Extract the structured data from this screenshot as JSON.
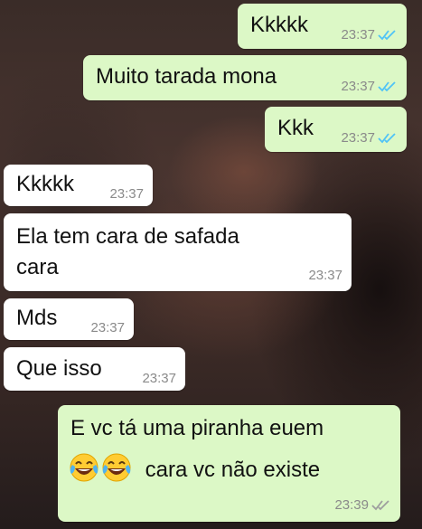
{
  "colors": {
    "outgoing_bubble": "#dcf8c6",
    "incoming_bubble": "#ffffff",
    "read_ticks": "#4fc3f7",
    "delivered_ticks": "#9e9e9e"
  },
  "messages": [
    {
      "direction": "outgoing",
      "text": "Kkkkk",
      "time": "23:37",
      "status": "read"
    },
    {
      "direction": "outgoing",
      "text": "Muito tarada mona",
      "time": "23:37",
      "status": "read"
    },
    {
      "direction": "outgoing",
      "text": "Kkk",
      "time": "23:37",
      "status": "read"
    },
    {
      "direction": "incoming",
      "text": "Kkkkk",
      "time": "23:37"
    },
    {
      "direction": "incoming",
      "text_line1": "Ela tem cara de safada",
      "text_line2": "cara",
      "time": "23:37"
    },
    {
      "direction": "incoming",
      "text": "Mds",
      "time": "23:37"
    },
    {
      "direction": "incoming",
      "text": "Que isso",
      "time": "23:37"
    },
    {
      "direction": "outgoing",
      "text_line1": "E vc tá uma piranha euem",
      "text_line2": "cara vc não existe",
      "emoji": "😂😂",
      "emoji_icons": [
        "tears-of-joy-emoji-icon",
        "tears-of-joy-emoji-icon"
      ],
      "time": "23:39",
      "status": "delivered"
    }
  ]
}
